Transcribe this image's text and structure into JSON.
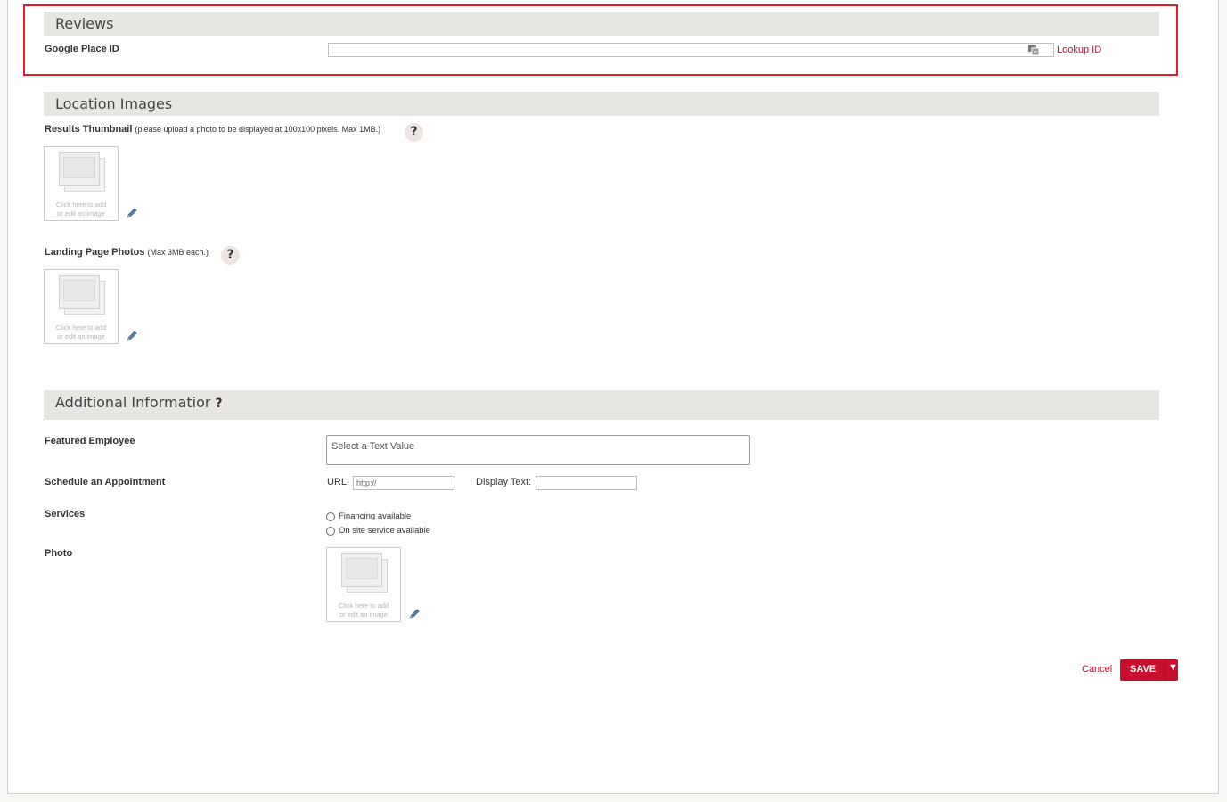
{
  "reviews": {
    "title": "Reviews",
    "google_place_id_label": "Google Place ID",
    "google_place_id_value": "",
    "lookup_label": "Lookup ID"
  },
  "location_images": {
    "title": "Location Images",
    "thumbnail_label": "Results Thumbnail",
    "thumbnail_note": "(please upload a photo to be displayed at 100x100 pixels. Max 1MB.)",
    "landing_label": "Landing Page Photos",
    "landing_note": "(Max 3MB each.)",
    "help_glyph": "?",
    "image_caption_line1": "Click here to add",
    "image_caption_line2": "or edit an image"
  },
  "additional": {
    "title": "Additional Information",
    "featured_employee_label": "Featured Employee",
    "featured_employee_placeholder": "Select a Text Value",
    "schedule_label": "Schedule an Appointment",
    "url_label": "URL:",
    "url_value": "http://",
    "display_text_label": "Display Text:",
    "display_text_value": "",
    "services_label": "Services",
    "services_options": [
      "Financing available",
      "On site service available"
    ],
    "photo_label": "Photo"
  },
  "actions": {
    "cancel_label": "Cancel",
    "save_label": "SAVE",
    "save_caret": "▼"
  },
  "colors": {
    "accent": "#c8102e",
    "highlight_border": "#e21f26",
    "section_header_bg": "#e6e6e2"
  }
}
